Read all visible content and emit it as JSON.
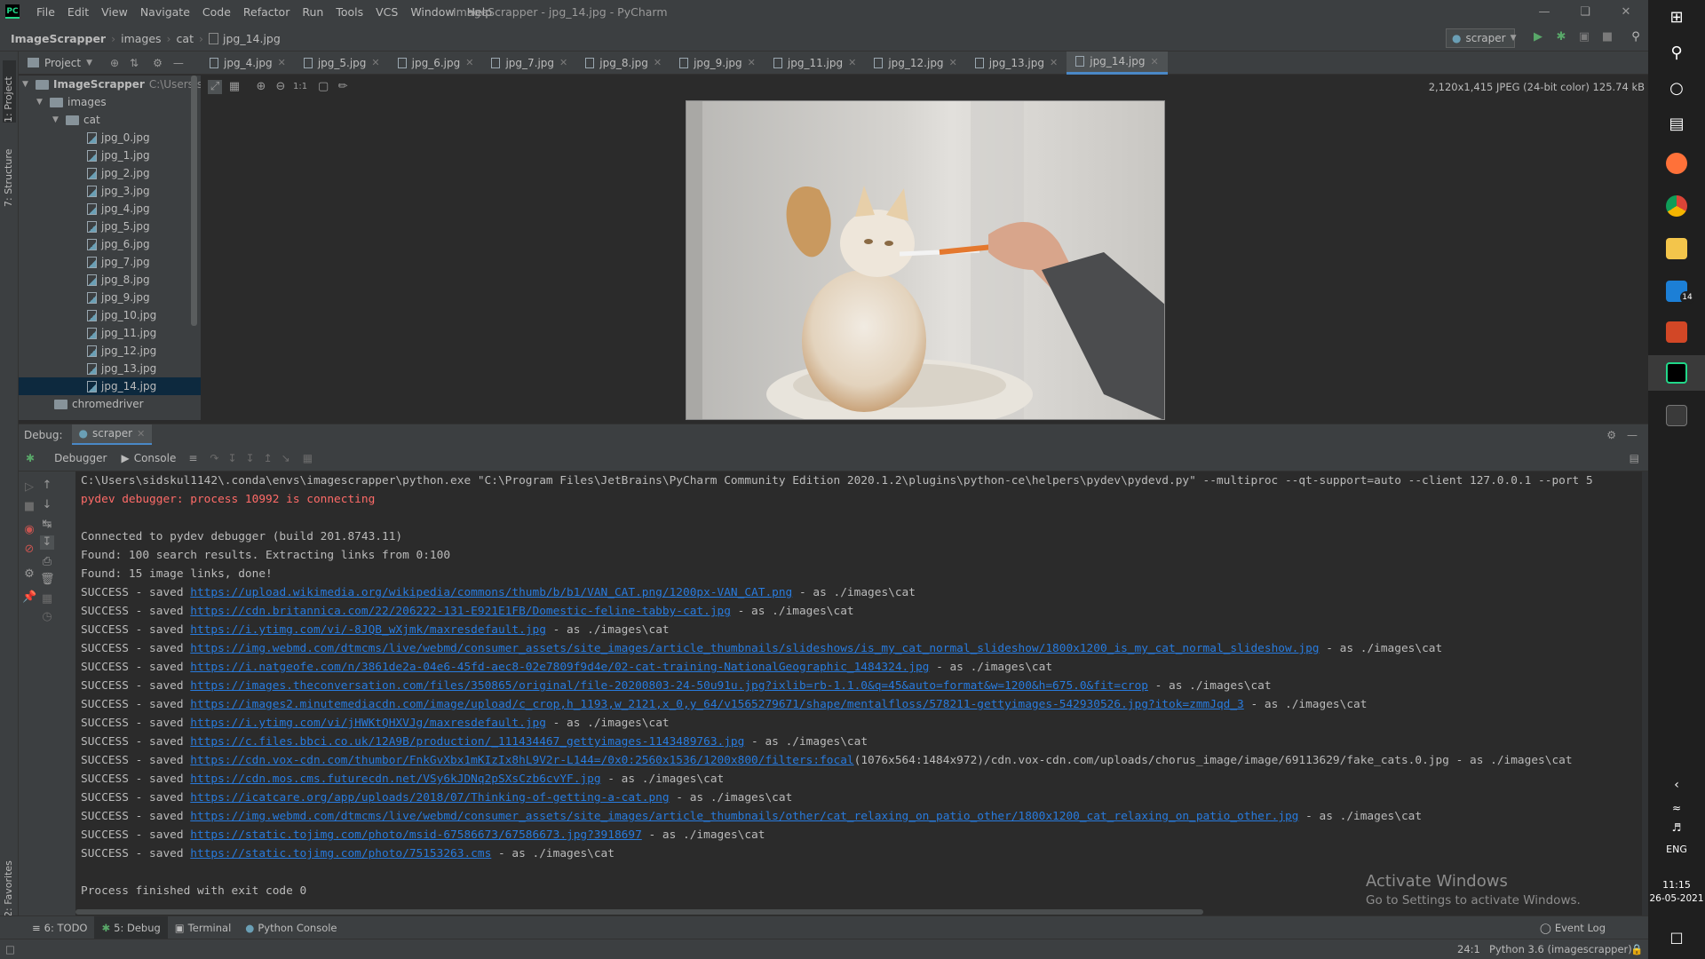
{
  "app": {
    "title": "ImageScrapper - jpg_14.jpg - PyCharm",
    "logo": "PC",
    "menu": [
      "File",
      "Edit",
      "View",
      "Navigate",
      "Code",
      "Refactor",
      "Run",
      "Tools",
      "VCS",
      "Window",
      "Help"
    ]
  },
  "navbar": {
    "breadcrumb": [
      "ImageScrapper",
      "images",
      "cat",
      "jpg_14.jpg"
    ],
    "run_config": "scraper"
  },
  "project_panel": {
    "title": "Project",
    "root": "ImageScrapper",
    "root_path": "C:\\Users\\sidsk",
    "folders": [
      "images",
      "cat"
    ],
    "files": [
      "jpg_0.jpg",
      "jpg_1.jpg",
      "jpg_2.jpg",
      "jpg_3.jpg",
      "jpg_4.jpg",
      "jpg_5.jpg",
      "jpg_6.jpg",
      "jpg_7.jpg",
      "jpg_8.jpg",
      "jpg_9.jpg",
      "jpg_10.jpg",
      "jpg_11.jpg",
      "jpg_12.jpg",
      "jpg_13.jpg",
      "jpg_14.jpg"
    ],
    "selected_file": "jpg_14.jpg",
    "extra": "chromedriver"
  },
  "left_strip": [
    "1: Project",
    "7: Structure",
    "2: Favorites"
  ],
  "editor_tabs": [
    "jpg_4.jpg",
    "jpg_5.jpg",
    "jpg_6.jpg",
    "jpg_7.jpg",
    "jpg_8.jpg",
    "jpg_9.jpg",
    "jpg_11.jpg",
    "jpg_12.jpg",
    "jpg_13.jpg",
    "jpg_14.jpg"
  ],
  "active_tab": "jpg_14.jpg",
  "viewer": {
    "image_info": "2,120x1,415 JPEG (24-bit color) 125.74 kB",
    "zoom_label": "1:1"
  },
  "debug": {
    "label": "Debug:",
    "config_tab": "scraper",
    "tabs": [
      "Debugger",
      "Console"
    ]
  },
  "console_lines": [
    {
      "text": "C:\\Users\\sidskul1142\\.conda\\envs\\imagescrapper\\python.exe \"C:\\Program Files\\JetBrains\\PyCharm Community Edition 2020.1.2\\plugins\\python-ce\\helpers\\pydev\\pydevd.py\" --multiproc --qt-support=auto --client 127.0.0.1 --port 5",
      "kind": "plain"
    },
    {
      "text": "pydev debugger: process 10992 is connecting",
      "kind": "err"
    },
    {
      "text": "",
      "kind": "plain"
    },
    {
      "text": "Connected to pydev debugger (build 201.8743.11)",
      "kind": "plain"
    },
    {
      "text": "Found: 100 search results. Extracting links from 0:100",
      "kind": "plain"
    },
    {
      "text": "Found: 15 image links, done!",
      "kind": "plain"
    },
    {
      "prefix": "SUCCESS - saved ",
      "url": "https://upload.wikimedia.org/wikipedia/commons/thumb/b/b1/VAN_CAT.png/1200px-VAN_CAT.png",
      "suffix": " - as ./images\\cat",
      "kind": "link"
    },
    {
      "prefix": "SUCCESS - saved ",
      "url": "https://cdn.britannica.com/22/206222-131-E921E1FB/Domestic-feline-tabby-cat.jpg",
      "suffix": " - as ./images\\cat",
      "kind": "link"
    },
    {
      "prefix": "SUCCESS - saved ",
      "url": "https://i.ytimg.com/vi/-8JQB_wXjmk/maxresdefault.jpg",
      "suffix": " - as ./images\\cat",
      "kind": "link"
    },
    {
      "prefix": "SUCCESS - saved ",
      "url": "https://img.webmd.com/dtmcms/live/webmd/consumer_assets/site_images/article_thumbnails/slideshows/is_my_cat_normal_slideshow/1800x1200_is_my_cat_normal_slideshow.jpg",
      "suffix": " - as ./images\\cat",
      "kind": "link"
    },
    {
      "prefix": "SUCCESS - saved ",
      "url": "https://i.natgeofe.com/n/3861de2a-04e6-45fd-aec8-02e7809f9d4e/02-cat-training-NationalGeographic_1484324.jpg",
      "suffix": " - as ./images\\cat",
      "kind": "link"
    },
    {
      "prefix": "SUCCESS - saved ",
      "url": "https://images.theconversation.com/files/350865/original/file-20200803-24-50u91u.jpg?ixlib=rb-1.1.0&q=45&auto=format&w=1200&h=675.0&fit=crop",
      "suffix": " - as ./images\\cat",
      "kind": "link"
    },
    {
      "prefix": "SUCCESS - saved ",
      "url": "https://images2.minutemediacdn.com/image/upload/c_crop,h_1193,w_2121,x_0,y_64/v1565279671/shape/mentalfloss/578211-gettyimages-542930526.jpg?itok=zmmJqd_3",
      "suffix": " - as ./images\\cat",
      "kind": "link"
    },
    {
      "prefix": "SUCCESS - saved ",
      "url": "https://i.ytimg.com/vi/jHWKtQHXVJg/maxresdefault.jpg",
      "suffix": " - as ./images\\cat",
      "kind": "link"
    },
    {
      "prefix": "SUCCESS - saved ",
      "url": "https://c.files.bbci.co.uk/12A9B/production/_111434467_gettyimages-1143489763.jpg",
      "suffix": " - as ./images\\cat",
      "kind": "link"
    },
    {
      "prefix": "SUCCESS - saved ",
      "url": "https://cdn.vox-cdn.com/thumbor/FnkGvXbx1mKIzIx8hL9V2r-L144=/0x0:2560x1536/1200x800/filters:focal",
      "suffix": "(1076x564:1484x972)/cdn.vox-cdn.com/uploads/chorus_image/image/69113629/fake_cats.0.jpg - as ./images\\cat",
      "kind": "link"
    },
    {
      "prefix": "SUCCESS - saved ",
      "url": "https://cdn.mos.cms.futurecdn.net/VSy6kJDNq2pSXsCzb6cvYF.jpg",
      "suffix": " - as ./images\\cat",
      "kind": "link"
    },
    {
      "prefix": "SUCCESS - saved ",
      "url": "https://icatcare.org/app/uploads/2018/07/Thinking-of-getting-a-cat.png",
      "suffix": " - as ./images\\cat",
      "kind": "link"
    },
    {
      "prefix": "SUCCESS - saved ",
      "url": "https://img.webmd.com/dtmcms/live/webmd/consumer_assets/site_images/article_thumbnails/other/cat_relaxing_on_patio_other/1800x1200_cat_relaxing_on_patio_other.jpg",
      "suffix": " - as ./images\\cat",
      "kind": "link"
    },
    {
      "prefix": "SUCCESS - saved ",
      "url": "https://static.tojimg.com/photo/msid-67586673/67586673.jpg?3918697",
      "suffix": " - as ./images\\cat",
      "kind": "link"
    },
    {
      "prefix": "SUCCESS - saved ",
      "url": "https://static.tojimg.com/photo/75153263.cms",
      "suffix": " - as ./images\\cat",
      "kind": "link"
    },
    {
      "text": "",
      "kind": "plain"
    },
    {
      "text": "Process finished with exit code 0",
      "kind": "plain"
    }
  ],
  "bottom_tabs": [
    "6: TODO",
    "5: Debug",
    "Terminal",
    "Python Console"
  ],
  "active_bottom_tab": "5: Debug",
  "event_log": "Event Log",
  "status": {
    "position": "24:1",
    "interpreter": "Python 3.6 (imagescrapper)"
  },
  "watermark": {
    "title": "Activate Windows",
    "subtitle": "Go to Settings to activate Windows."
  },
  "taskbar": {
    "language": "ENG",
    "time": "11:15",
    "date": "26-05-2021",
    "mail_badge": "14"
  },
  "colors": {
    "accent": "#4a88c7",
    "link": "#287bde",
    "error": "#ff6b68",
    "selection": "#0d293e"
  }
}
